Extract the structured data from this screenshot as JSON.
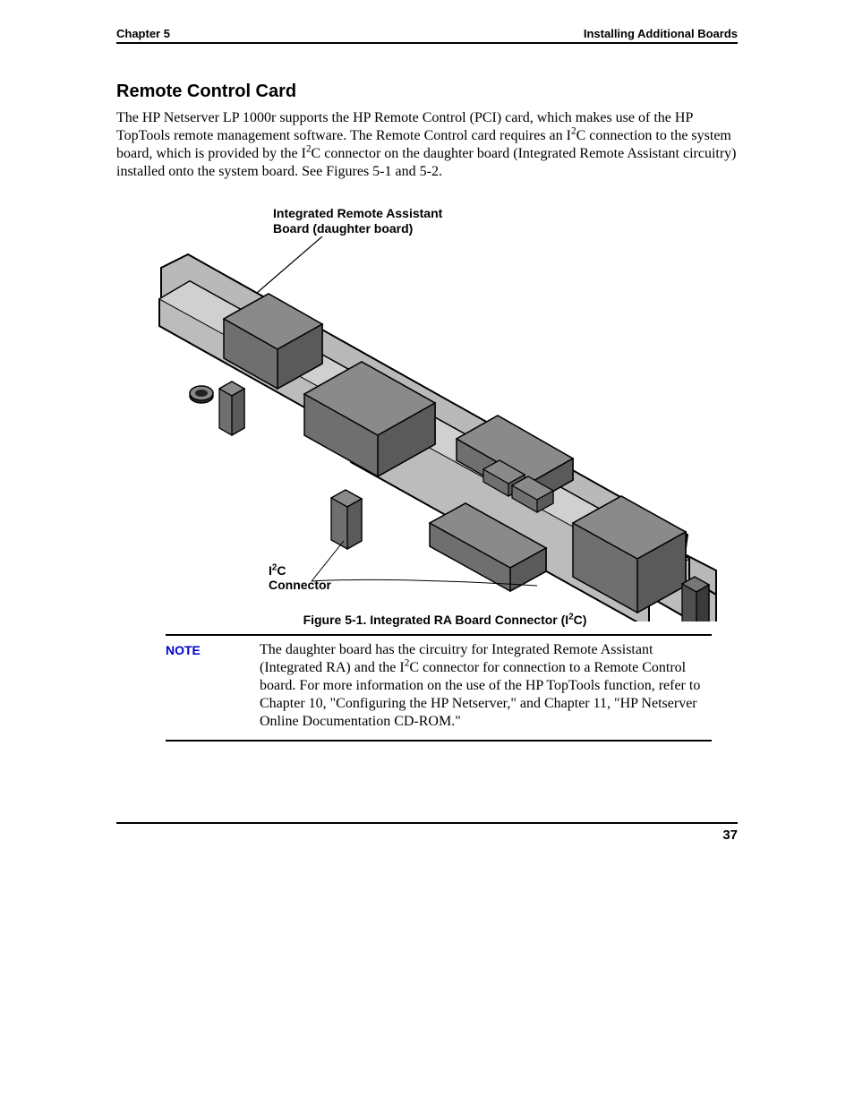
{
  "header": {
    "left": "Chapter 5",
    "right": "Installing Additional Boards"
  },
  "section_title": "Remote Control Card",
  "body_paragraph_parts": {
    "p1": "The HP Netserver LP 1000r supports the HP Remote Control (PCI) card, which makes use of the HP TopTools remote management software. The Remote Control card requires an I",
    "p2": "C connection to the system board, which is provided by the I",
    "p3": "C connector on the daughter board (Integrated Remote Assistant circuitry) installed onto the system board. See Figures 5-1 and 5-2."
  },
  "figure": {
    "label_top_line1": "Integrated Remote Assistant",
    "label_top_line2": "Board (daughter board)",
    "connector_label_line1_prefix": "I",
    "connector_label_line1_suffix": "C",
    "connector_label_line2": "Connector",
    "caption_prefix": "Figure 5-1. Integrated RA Board Connector (I",
    "caption_suffix": "C)"
  },
  "note": {
    "label": "NOTE",
    "text_p1": "The daughter board has the circuitry for Integrated Remote Assistant (Integrated RA) and the I",
    "text_p2": "C connector for connection to a Remote Control board.  For more information on the use of the HP TopTools function, refer to Chapter 10, \"Configuring the HP Netserver,\" and Chapter 11, \"HP Netserver Online Documentation CD-ROM.\""
  },
  "page_number": "37"
}
